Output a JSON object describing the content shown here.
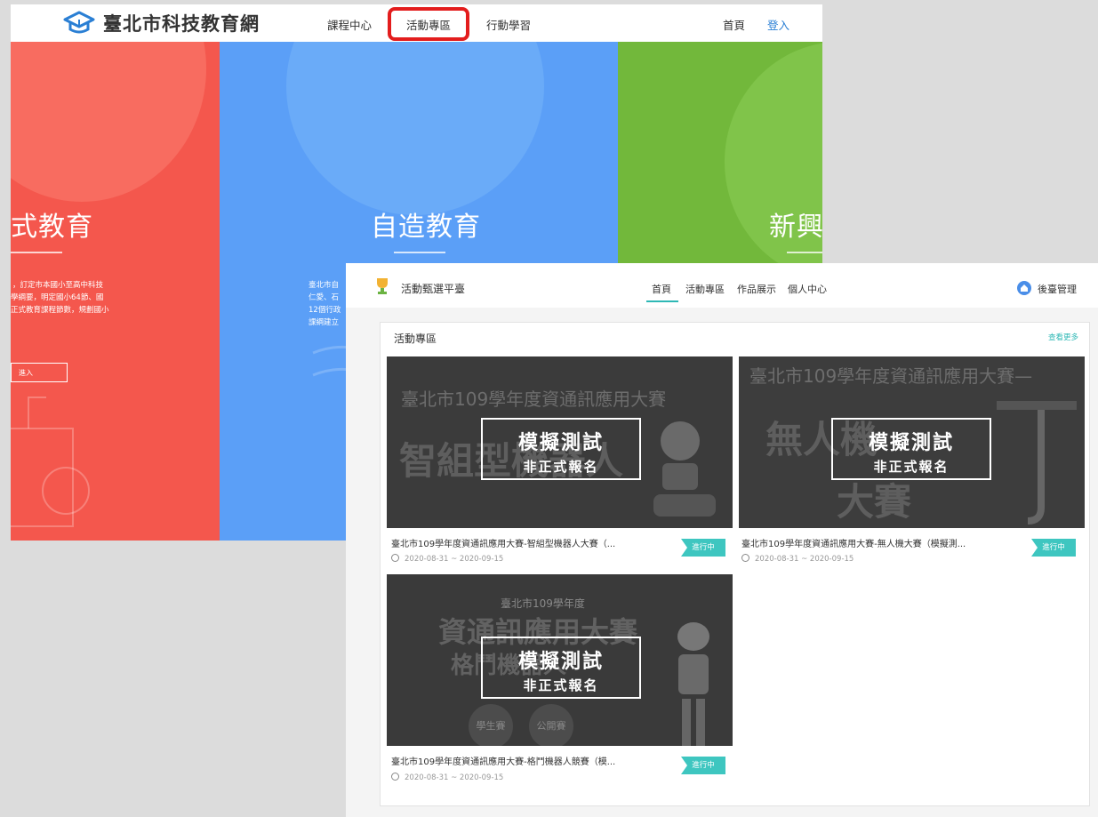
{
  "back_window": {
    "logo_text": "臺北市科技教育網",
    "nav": {
      "course_center": "課程中心",
      "activity_zone": "活動專區",
      "mobile_learning": "行動學習",
      "home": "首頁",
      "login": "登入"
    },
    "panels": {
      "red": {
        "title": "式教育",
        "desc_lines": [
          "，訂定市本國小至高中科技",
          "學綱要，明定國小64節、國",
          "正式教育課程節數，規劃國小"
        ],
        "button": "進入"
      },
      "blue": {
        "title": "自造教育",
        "desc_lines": [
          "臺北市自",
          "仁愛、石",
          "12個行政",
          "課綱建立"
        ]
      },
      "green": {
        "title": "新興科"
      }
    },
    "highlight_color": "#e31d1d"
  },
  "front_window": {
    "title": "活動甄選平臺",
    "nav": {
      "home": "首頁",
      "activity_zone": "活動專區",
      "works": "作品展示",
      "personal": "個人中心"
    },
    "admin": "後臺管理",
    "section_title": "活動專區",
    "more": "查看更多",
    "accent_color": "#3ec6c0",
    "items": [
      {
        "banner_subtitle": "臺北市109學年度資通訊應用大賽",
        "banner_bg_text": "智組型機器人",
        "overlay_line1": "模擬測試",
        "overlay_line2": "非正式報名",
        "title": "臺北市109學年度資通訊應用大賽-智組型機器人大賽（...",
        "date": "2020-08-31 ~ 2020-09-15",
        "status": "進行中"
      },
      {
        "banner_subtitle": "臺北市109學年度資通訊應用大賽—",
        "banner_bg_text": "無人機",
        "banner_bg_text2": "大賽",
        "overlay_line1": "模擬測試",
        "overlay_line2": "非正式報名",
        "title": "臺北市109學年度資通訊應用大賽-無人機大賽（模擬測...",
        "date": "2020-08-31 ~ 2020-09-15",
        "status": "進行中"
      },
      {
        "banner_subtitle": "臺北市109學年度",
        "banner_bg_text": "資通訊應用大賽",
        "banner_bg_text2": "格鬥機器人",
        "badge_student": "學生賽",
        "badge_open": "公開賽",
        "overlay_line1": "模擬測試",
        "overlay_line2": "非正式報名",
        "title": "臺北市109學年度資通訊應用大賽-格鬥機器人競賽（模...",
        "date": "2020-08-31 ~ 2020-09-15",
        "status": "進行中"
      }
    ]
  }
}
